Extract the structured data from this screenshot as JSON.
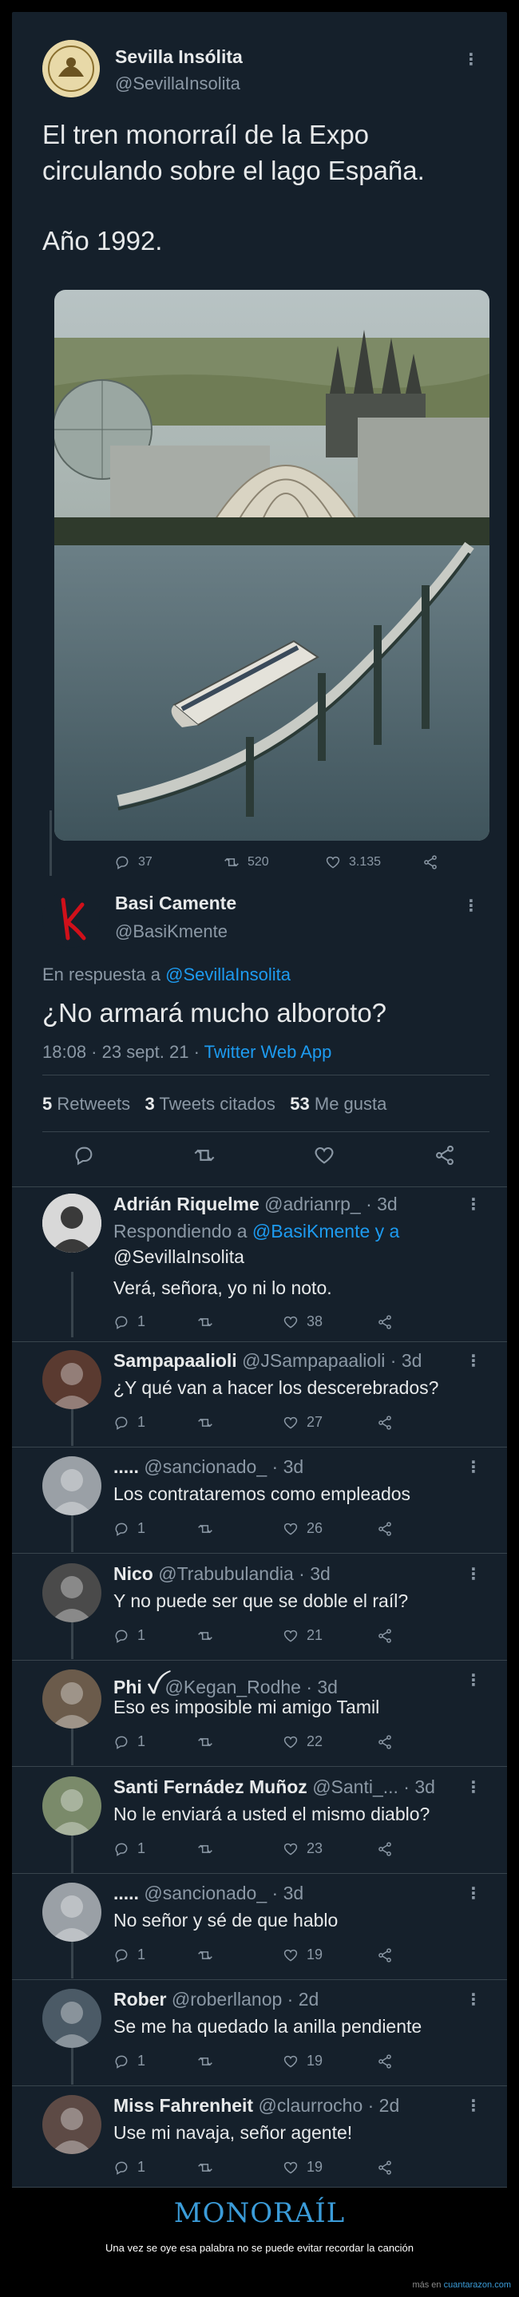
{
  "main_tweet": {
    "author_name": "Sevilla Insólita",
    "author_handle": "@SevillaInsolita",
    "text_line1": "El tren monorraíl de la Expo",
    "text_line2": "circulando sobre el lago España.",
    "text_line3": "Año 1992.",
    "reply_count": "37",
    "retweet_count": "520",
    "like_count": "3.135"
  },
  "reply_tweet": {
    "author_name": "Basi Camente",
    "author_handle": "@BasiKmente",
    "in_reply_prefix": "En respuesta a",
    "in_reply_handle": "@SevillaInsolita",
    "text": "¿No armará mucho alboroto?",
    "timestamp": "18:08 · 23 sept. 21 ·",
    "source": "Twitter Web App",
    "retweets_value": "5",
    "retweets_label": "Retweets",
    "quotes_value": "3",
    "quotes_label": "Tweets citados",
    "likes_value": "53",
    "likes_label": "Me gusta"
  },
  "replies": [
    {
      "name": "Adrián Riquelme",
      "meta": "@adrianrp_ · 3d",
      "replying_prefix": "Respondiendo a",
      "replying_line1": "@BasiKmente y a",
      "replying_line2": "@SevillaInsolita",
      "text": "Verá, señora, yo ni lo noto.",
      "reply_count": "1",
      "like_count": "38"
    },
    {
      "name": "Sampapaalioli",
      "meta": "@JSampapaalioli · 3d",
      "text": "¿Y qué van a hacer los descerebrados?",
      "reply_count": "1",
      "like_count": "27"
    },
    {
      "name": ".....",
      "meta": "@sancionado_ · 3d",
      "text": "Los contrataremos como empleados",
      "reply_count": "1",
      "like_count": "26"
    },
    {
      "name": "Nico",
      "meta": "@Trabubulandia · 3d",
      "text": "Y no puede ser que se doble el raíl?",
      "reply_count": "1",
      "like_count": "21"
    },
    {
      "name": "Phi ꪜ",
      "meta": "@Kegan_Rodhe · 3d",
      "text": "Eso es imposible mi amigo Tamil",
      "reply_count": "1",
      "like_count": "22"
    },
    {
      "name": "Santi Fernádez Muñoz",
      "meta": "@Santi_... · 3d",
      "text": "No le enviará a usted el mismo diablo?",
      "reply_count": "1",
      "like_count": "23"
    },
    {
      "name": ".....",
      "meta": "@sancionado_ · 3d",
      "text": "No señor y sé de que hablo",
      "reply_count": "1",
      "like_count": "19"
    },
    {
      "name": "Rober",
      "meta": "@roberllanop · 2d",
      "text": "Se me ha quedado la anilla pendiente",
      "reply_count": "1",
      "like_count": "19"
    },
    {
      "name": "Miss Fahrenheit",
      "meta": "@claurrocho · 2d",
      "text": "Use mi navaja, señor agente!",
      "reply_count": "1",
      "like_count": "19"
    }
  ],
  "footer": {
    "title": "MONORAÍL",
    "subtitle": "Una vez se oye esa palabra no se puede evitar recordar la canción",
    "credit_prefix": "más en",
    "credit_site": "cuantarazon.com"
  },
  "colors": {
    "background": "#15202b",
    "accent": "#1d9bf0",
    "muted": "#8b98a5",
    "footer_title": "#3b9cd9"
  },
  "icons": [
    "reply-icon",
    "retweet-icon",
    "like-icon",
    "share-icon",
    "more-icon"
  ]
}
